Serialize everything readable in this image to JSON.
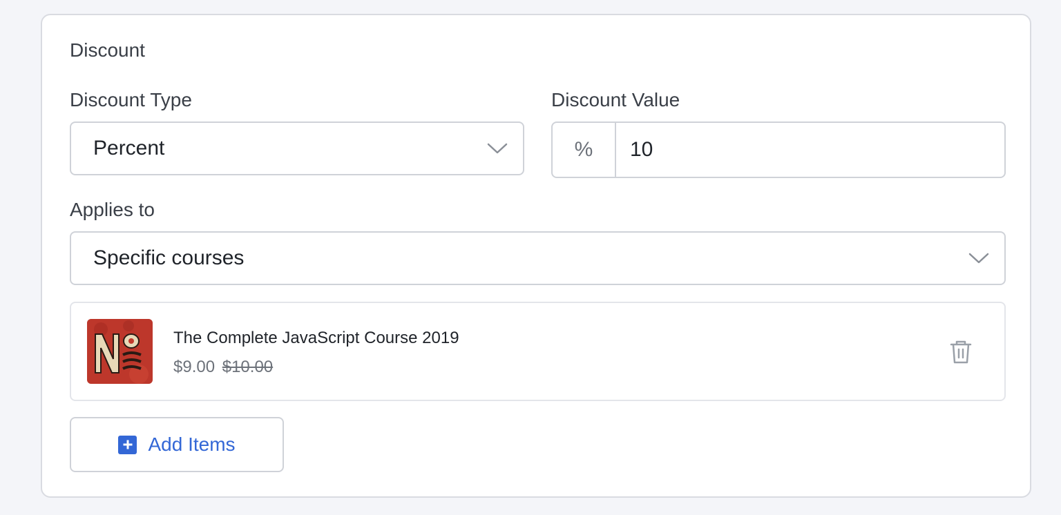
{
  "discount": {
    "section_title": "Discount",
    "type": {
      "label": "Discount Type",
      "selected": "Percent"
    },
    "value": {
      "label": "Discount Value",
      "unit_symbol": "%",
      "current_value": "10"
    },
    "applies_to": {
      "label": "Applies to",
      "selected": "Specific courses"
    },
    "items": [
      {
        "title": "The Complete JavaScript Course 2019",
        "price": "$9.00",
        "original_price": "$10.00",
        "thumbnail_icon": "course-thumbnail-image"
      }
    ],
    "add_button": {
      "label": "Add Items",
      "icon": "plus-square-icon"
    }
  },
  "colors": {
    "background": "#f4f5f9",
    "accent": "#3367d6",
    "border": "#cfd2d8",
    "muted_text": "#6d727a"
  }
}
